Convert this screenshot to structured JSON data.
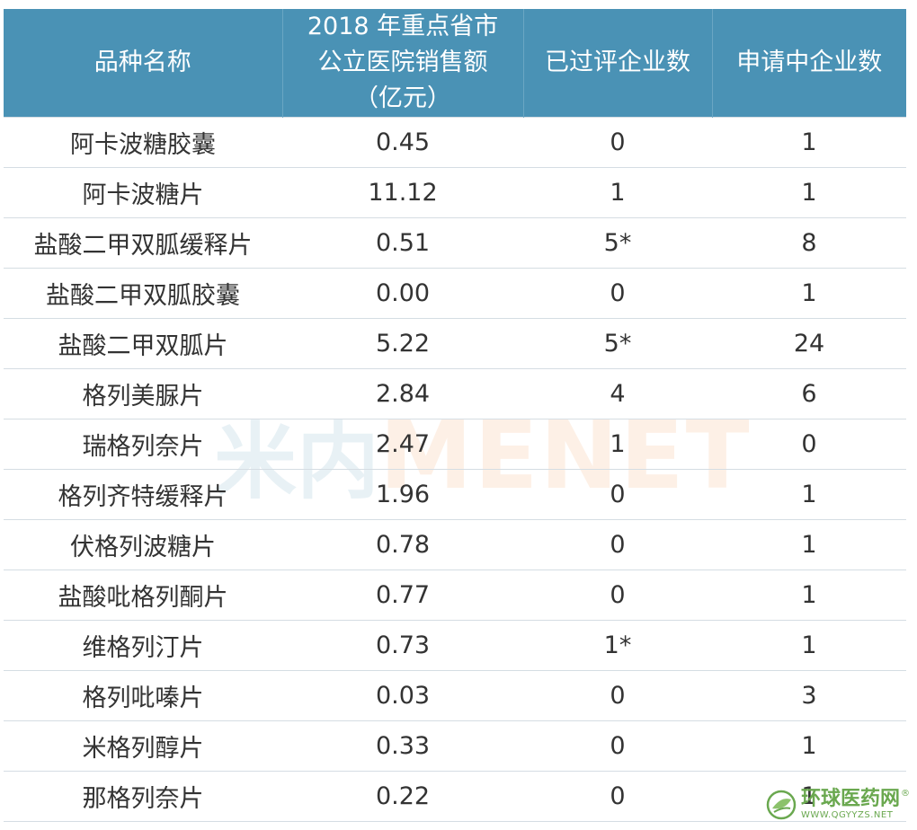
{
  "table": {
    "headers": [
      "品种名称",
      "2018 年重点省市公立医院销售额（亿元）",
      "已过评企业数",
      "申请中企业数"
    ],
    "rows": [
      [
        "阿卡波糖胶囊",
        "0.45",
        "0",
        "1"
      ],
      [
        "阿卡波糖片",
        "11.12",
        "1",
        "1"
      ],
      [
        "盐酸二甲双胍缓释片",
        "0.51",
        "5*",
        "8"
      ],
      [
        "盐酸二甲双胍胶囊",
        "0.00",
        "0",
        "1"
      ],
      [
        "盐酸二甲双胍片",
        "5.22",
        "5*",
        "24"
      ],
      [
        "格列美脲片",
        "2.84",
        "4",
        "6"
      ],
      [
        "瑞格列奈片",
        "2.47",
        "1",
        "0"
      ],
      [
        "格列齐特缓释片",
        "1.96",
        "0",
        "1"
      ],
      [
        "伏格列波糖片",
        "0.78",
        "0",
        "1"
      ],
      [
        "盐酸吡格列酮片",
        "0.77",
        "0",
        "1"
      ],
      [
        "维格列汀片",
        "0.73",
        "1*",
        "1"
      ],
      [
        "格列吡嗪片",
        "0.03",
        "0",
        "3"
      ],
      [
        "米格列醇片",
        "0.33",
        "0",
        "1"
      ],
      [
        "那格列奈片",
        "0.22",
        "0",
        "1"
      ]
    ]
  },
  "watermark": {
    "cn": "米内",
    "en": "MENET"
  },
  "logo": {
    "name": "环球医药网",
    "url": "WWW.QGYYZS.NET",
    "reg": "®",
    "icon": "globe-leaf-icon"
  },
  "colors": {
    "header_bg": "#4a92b5",
    "header_text": "#ffffff",
    "row_border": "#d5dde3",
    "logo_green": "#6aa84f"
  }
}
